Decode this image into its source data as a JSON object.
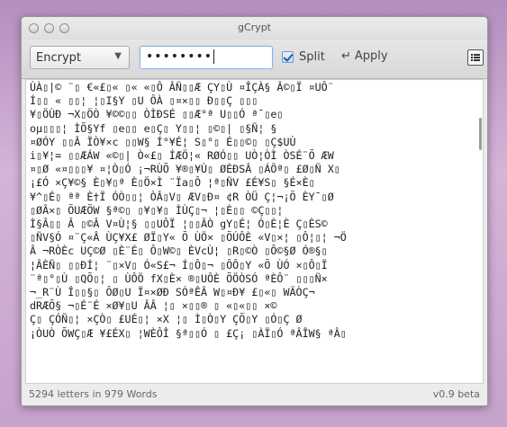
{
  "window": {
    "title": "gCrypt"
  },
  "toolbar": {
    "mode": "Encrypt",
    "mode_arrow_icon": "triangle-down",
    "password_masked": "••••••••",
    "split_label": "Split",
    "split_checked": true,
    "apply_label": "Apply",
    "apply_icon": "return-arrow",
    "menu_icon": "list-menu"
  },
  "content": {
    "lines": [
      "ÙÀ\u0001|© ¨\u0001 €«£\u0002« \u0001« «\u0002Ô ÂÑ\u0001\u0002Æ ÇY\u0002Ù ¤ÎÇÀ§ Â©\u0001Ï ¤UÔ¨",
      "Í\u0001\u0002 « \u0001\u0002¦ ¦\u0001I§Y \u0001U ÔÀ \u0001¤×\u0001\u0002 Ð\u0001\u0002Ç \u0001\u0002\u0002",
      "¥\u0002ÖÙÐ ¬X\u0002ÖÒ ¥©©\u0002\u0002 ÒÌÐSÉ \u0002\u0002Æ°ª U\u0002\u0002Ó ª¯\u0002e\u0002",
      "oµ\u0002\u0002\u0002¦ ÌÕ§Yf \u0002e\u0002\u0002 e\u0002Ç\u0002 Y\u0002\u0002¦ \u0002©\u0002| \u0002§Ñ¦ §",
      "¤ØÓY \u0002\u0002Â ÏÒ¥×c \u0002\u0002W§ Í°¥É¦ S\u0002°\u0002 É\u0002\u0002©\u0002 \u0002Ç$UÙ",
      "i\u0002¥¦= \u0002\u0002ÆÁW «©\u0002| Ò«£\u0002 ÍÆÖ¦« RØÓ\u0002\u0002 UÒ¦ÒÌ ÒSÉ¨Õ ÆW",
      "¤\u0002Ø «¤\u0002\u0002\u0002¥ ¤¦Ò\u0002Ó ¡¬RÙÕ ¥®\u0002¥Ù\u0002 ØÈÐSÂ \u0002ÁÖª\u0002 £Ø\u0002Ñ X\u0002",
      "¡£Ó ×Ç¥©§ È\u0002¥\u0002ª È\u0002Ö×Ì ¨Ïa\u0002Ô ¦ª\u0002ÑV £É¥S\u0002 §É×È\u0002",
      "¥^\u0002É\u0002 ªª È†Ï ÓÒ\u0002\u0002¦ ÒÂ\u0002V\u0002 ÆV\u0002Ð¤ ¢R ÒÜ Ç¦¬¡Õ ÈY¯\u0002Ø",
      "\u0002ØÂ×\u0002 ÕUÆÕW §ª©\u0002 \u0002¥\u0002¥\u0002 ÌÙÇ\u0002¬ ¦\u0002È\u0002\u0002 ©Ç\u0002\u0002¦",
      "Ì§Â\u0002\u0002 Â \u0002©Â V¤Ù¦§ \u0002\u0002UÔÏ ¦\u0002\u0002ÂÒ gY\u0002É¦ Ó\u0002È¦È Ç\u0002ÈS©",
      "\u0002ÑV§Ó ¤¨Ç«Â ÙÇ¥X£ ØÏ\u0002Y« Õ ÙÖ× \u0002ÕÚÔÈ «V\u0002×¦ \u0002Ô¦\u0002¦ ¬Ö",
      "Â ¬RÒÈc UÇ©Ø \u0002È¨É\u0002 Ô\u0002W©\u0002 ÈVcÙ¦ \u0002R\u0002©Ò \u0002Ô©§Ø Ó®§\u0002",
      "¦ÂÈÑ\u0002 \u0002\u0002ÐÍ¦ ¨\u0002×V\u0002 Ó«S£¬ Í\u0002Ô\u0002¬ \u0002ÔÔ\u0002Y «Õ ÙÓ ×\u0002Ô\u0002Ï",
      "¨ª\u0002°\u0002Ù \u0002QÕ\u0002¦ \u0002 ÙÔÖ fX\u0002È× ®\u0002UÔÈ ÕÖÒSÓ ªÈÔ¨ \u0002\u0002\u0002Ñ×",
      "¬_R¨Ù Î\u0002\u0002§\u0002 ÔØ\u0002U Ï¤×ØÐ SÓªÊÂ W\u0002¤Ð¥ £\u0002«\u0002 WÄÒÇ¬",
      "dRÆÕ§ ¬\u0002É¨É ×Ø¥\u0002U ÂÂ ¦\u0002 ×\u0002\u0002® \u0002 «\u0002«\u0002\u0002 ×©",
      "Ç\u0002 ÇÓÑ\u0002¦ ×ÇÒ\u0002 £UÉ\u0002¦ ×X ¦\u0002 Ì\u0002Ò\u0002Y ÇÕ\u0002Y \u0002Ó\u0002Ç Ø",
      "¡ÒUÒ ÕWÇ\u0002Æ ¥£ÉX\u0002 ¦WÈÔÎ §ª\u0002\u0002Ó \u0002 £Ç¡ \u0002ÀÏ\u0002Ó ªÂÎW§ ªÂ\u0002"
    ]
  },
  "status": {
    "summary": "5294 letters in 979 Words",
    "version": "v0.9 beta"
  }
}
